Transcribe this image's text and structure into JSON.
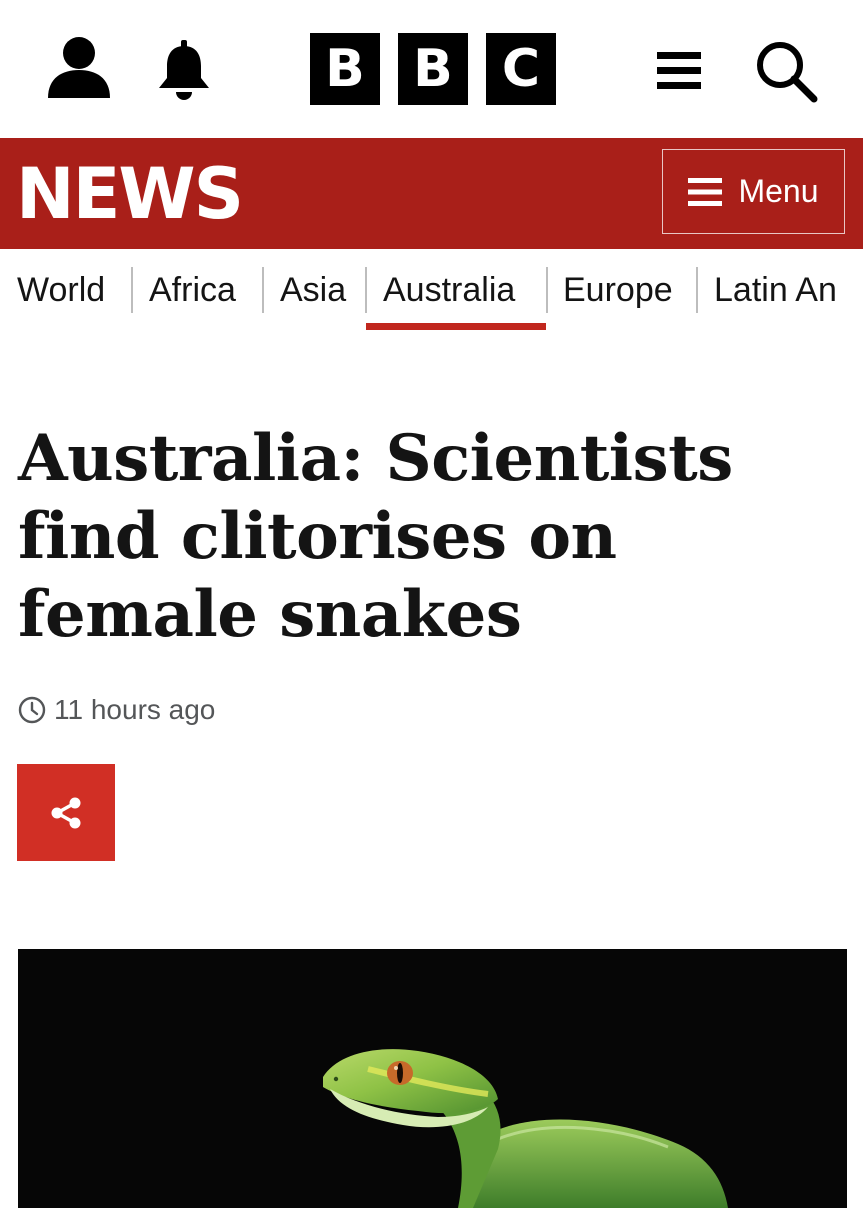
{
  "header": {
    "logo_letters": [
      "B",
      "B",
      "C"
    ],
    "icons": [
      "account-icon",
      "bell-icon",
      "hamburger-icon",
      "search-icon"
    ]
  },
  "news_bar": {
    "title": "NEWS",
    "menu_label": "Menu",
    "background": "#a91f19"
  },
  "nav": {
    "items": [
      "World",
      "Africa",
      "Asia",
      "Australia",
      "Europe",
      "Latin An"
    ],
    "active": "Australia",
    "accent": "#c1271e"
  },
  "article": {
    "headline": "Australia: Scientists find clitorises on female snakes",
    "timestamp": "11 hours ago",
    "share_color": "#d12f25"
  }
}
